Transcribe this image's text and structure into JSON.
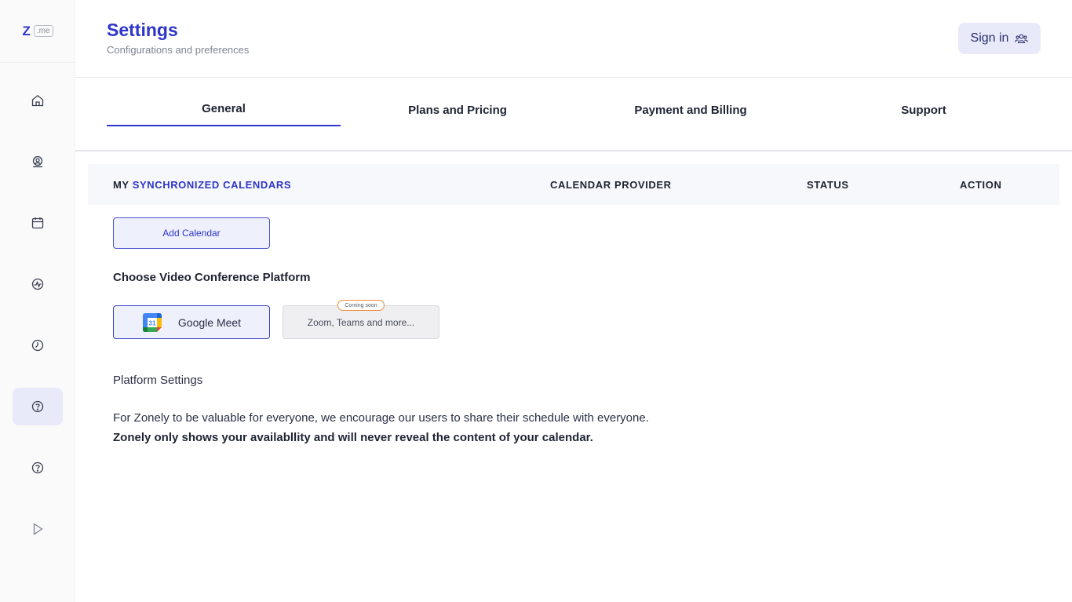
{
  "logo": {
    "letter": "Z",
    "suffix": ".me"
  },
  "header": {
    "title": "Settings",
    "subtitle": "Configurations and preferences",
    "signin_label": "Sign in"
  },
  "sidebar": {
    "items": [
      {
        "icon": "home-icon"
      },
      {
        "icon": "location-user-icon"
      },
      {
        "icon": "calendar-icon"
      },
      {
        "icon": "activity-icon"
      },
      {
        "icon": "clock-icon"
      },
      {
        "icon": "settings-help-icon",
        "active": true
      },
      {
        "icon": "help-icon"
      },
      {
        "icon": "play-icon"
      }
    ]
  },
  "tabs": [
    {
      "label": "General",
      "active": true
    },
    {
      "label": "Plans and Pricing"
    },
    {
      "label": "Payment and Billing"
    },
    {
      "label": "Support"
    }
  ],
  "calendars": {
    "col_my": "MY",
    "col_synchronized": "SYNCHRONIZED CALENDARS",
    "col_provider": "CALENDAR PROVIDER",
    "col_status": "STATUS",
    "col_action": "ACTION",
    "add_label": "Add Calendar"
  },
  "video": {
    "title": "Choose Video Conference Platform",
    "google_meet_label": "Google Meet",
    "google_calendar_day": "31",
    "other_label": "Zoom, Teams and more...",
    "coming_soon": "Coming soon"
  },
  "platform": {
    "title": "Platform Settings",
    "info_line_1": "For Zonely to be valuable for everyone, we encourage our users to share their schedule with everyone.",
    "info_line_2": "Zonely only shows your availabllity and will never reveal the content of your calendar."
  },
  "colors": {
    "accent": "#2d36c9",
    "active_bg": "#e9eaf9",
    "badge_border": "#f08a3c"
  }
}
